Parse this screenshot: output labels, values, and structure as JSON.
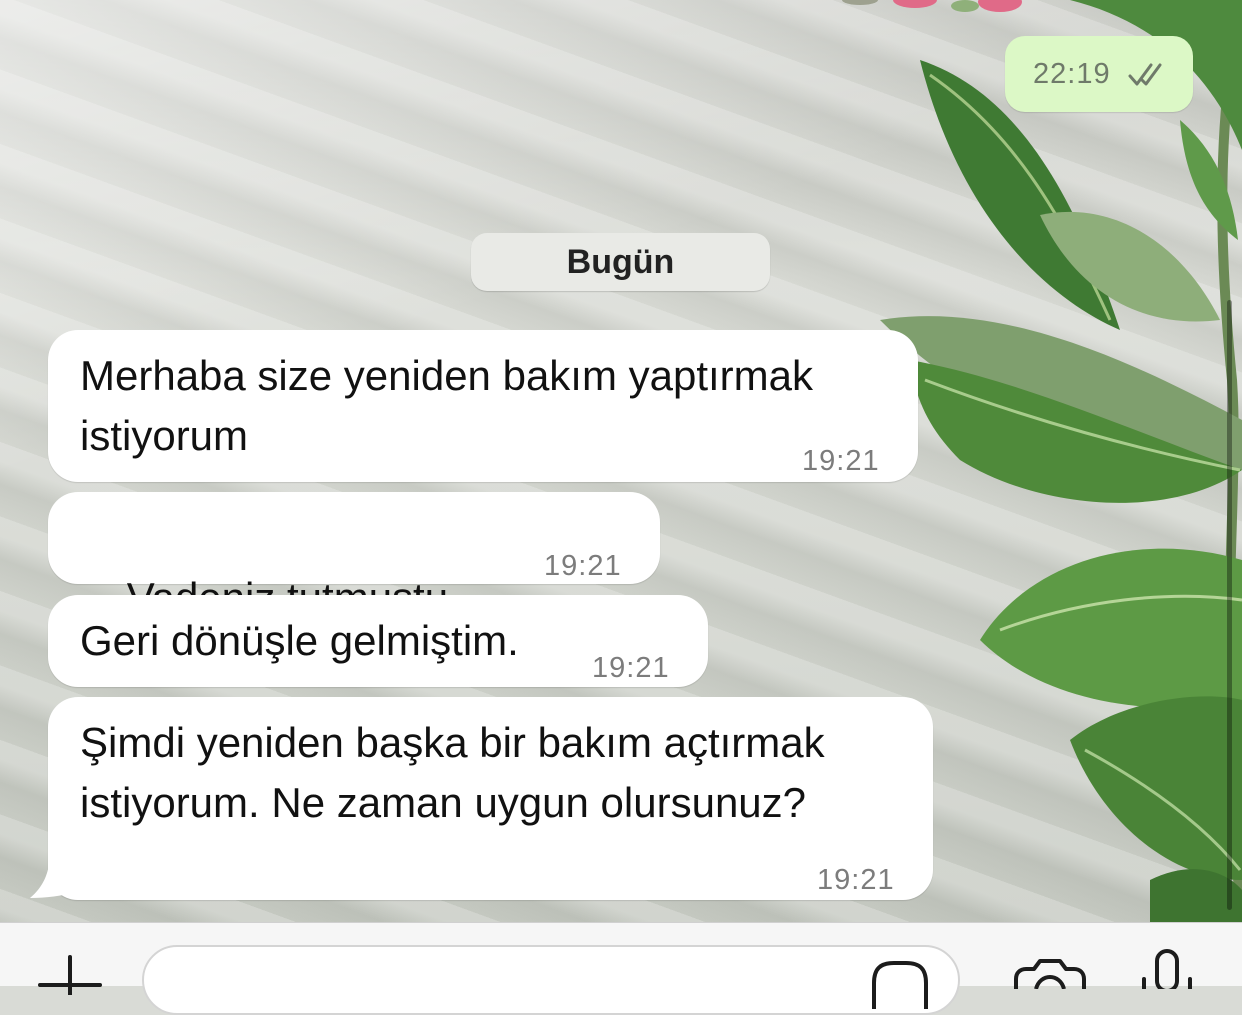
{
  "chat": {
    "date_divider": "Bugün",
    "outgoing": [
      {
        "time": "22:19",
        "status": "read-double-check"
      }
    ],
    "incoming": [
      {
        "text": "Merhaba size yeniden bakım yaptırmak\nistiyorum",
        "time": "19:21"
      },
      {
        "text": "Vadeniz tutmuştu",
        "emoji": "😊",
        "time": "19:21"
      },
      {
        "text": "Geri dönüşle gelmiştim.",
        "time": "19:21"
      },
      {
        "text": "Şimdi yeniden başka bir bakım açtırmak\nistiyorum. Ne zaman uygun olursunuz?",
        "time": "19:21"
      }
    ]
  },
  "input_bar": {
    "icons": [
      "plus-icon",
      "sticker-icon",
      "camera-icon",
      "microphone-icon"
    ]
  },
  "colors": {
    "incoming_bubble": "#ffffff",
    "outgoing_bubble": "#dcf8c6",
    "timestamp": "#7c7c7c"
  }
}
